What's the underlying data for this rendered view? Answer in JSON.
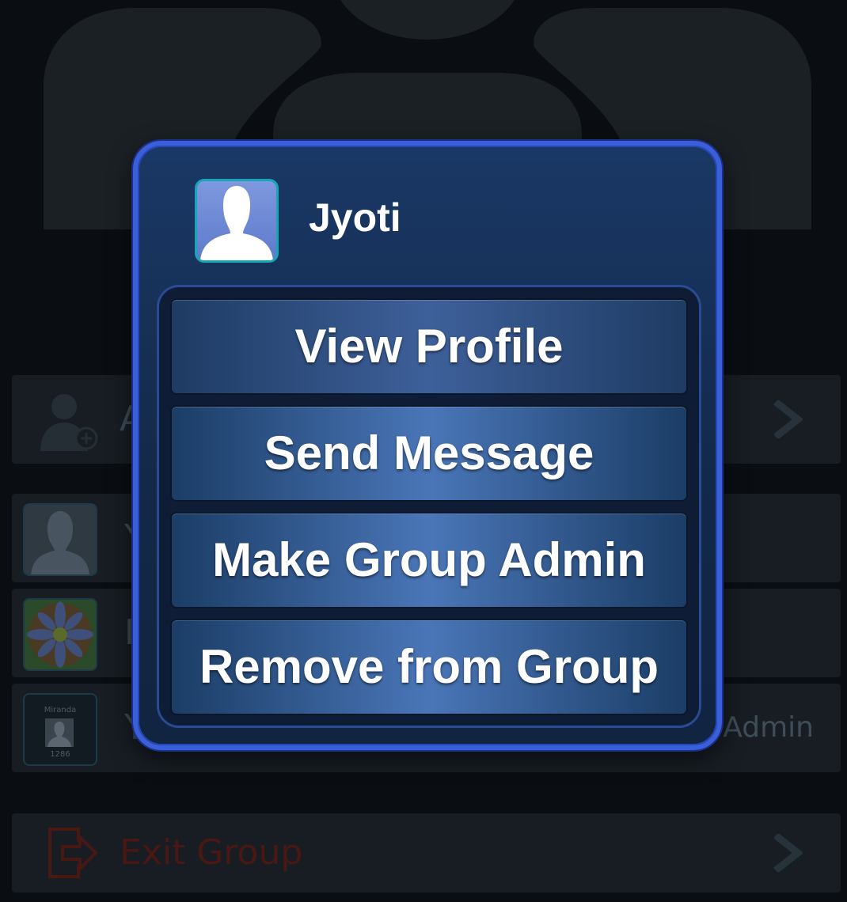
{
  "background": {
    "add_member_label": "A",
    "members": [
      {
        "name": "Y"
      },
      {
        "name": "I"
      },
      {
        "name": "Y",
        "role": "Admin",
        "thumb_caption_top": "Miranda",
        "thumb_caption_bottom": "1286"
      }
    ],
    "exit_label": "Exit Group"
  },
  "dialog": {
    "name": "Jyoti",
    "actions": {
      "view_profile": "View Profile",
      "send_message": "Send Message",
      "make_admin": "Make Group Admin",
      "remove": "Remove from Group"
    }
  },
  "colors": {
    "dialog_border": "#3a5fd8",
    "button_center": "#4a76b8",
    "exit_red": "#4a1813",
    "avatar_border": "#17a5b8"
  },
  "icons": [
    "group-silhouette-icon",
    "add-member-icon",
    "chevron-right-icon",
    "exit-icon",
    "default-avatar-icon"
  ]
}
